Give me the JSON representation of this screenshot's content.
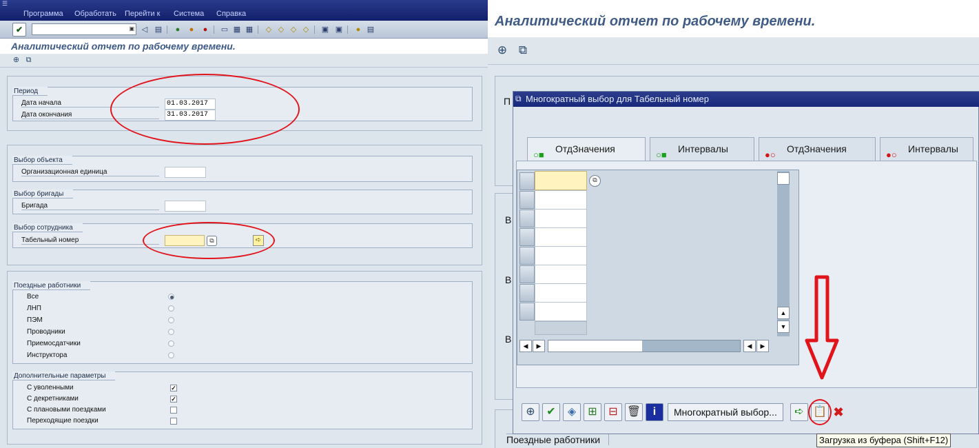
{
  "left": {
    "menu": [
      "Программа",
      "Обработать",
      "Перейти к",
      "Система",
      "Справка"
    ],
    "title": "Аналитический отчет по рабочему времени.",
    "period": {
      "title": "Период",
      "start_label": "Дата начала",
      "start_value": "01.03.2017",
      "end_label": "Дата окончания",
      "end_value": "31.03.2017"
    },
    "object_selection": {
      "title": "Выбор объекта",
      "org_unit_label": "Организационная единица"
    },
    "brigade_selection": {
      "title": "Выбор бригады",
      "brigade_label": "Бригада"
    },
    "employee_selection": {
      "title": "Выбор сотрудника",
      "personnel_label": "Табельный номер"
    },
    "train_workers": {
      "title": "Поездные работники",
      "options": [
        "Все",
        "ЛНП",
        "ПЭМ",
        "Проводники",
        "Приемосдатчики",
        "Инструктора"
      ],
      "selected": "Все"
    },
    "additional": {
      "title": "Дополнительные параметры",
      "options": [
        {
          "label": "С уволенными",
          "checked": true
        },
        {
          "label": "С декретниками",
          "checked": true
        },
        {
          "label": "С плановыми поездками",
          "checked": false
        },
        {
          "label": "Переходящие поездки",
          "checked": false
        }
      ]
    }
  },
  "right": {
    "title": "Аналитический отчет по рабочему времени.",
    "bg_letters": [
      "П",
      "В",
      "В",
      "В"
    ],
    "dialog": {
      "title": "Многократный выбор для Табельный номер",
      "tabs": [
        {
          "label": "ОтдЗначения",
          "lamp": "green"
        },
        {
          "label": "Интервалы",
          "lamp": "green"
        },
        {
          "label": "ОтдЗначения",
          "lamp": "red"
        },
        {
          "label": "Интервалы",
          "lamp": "red"
        }
      ],
      "multi_select_label": "Многократный выбор...",
      "tooltip": "Загрузка из буфера  (Shift+F12)"
    },
    "bottom_group_title": "Поездные работники"
  },
  "colors": {
    "annotation_red": "#e2141b",
    "sap_titlebar": "#1a2a7c",
    "title_text": "#3d5a88"
  }
}
